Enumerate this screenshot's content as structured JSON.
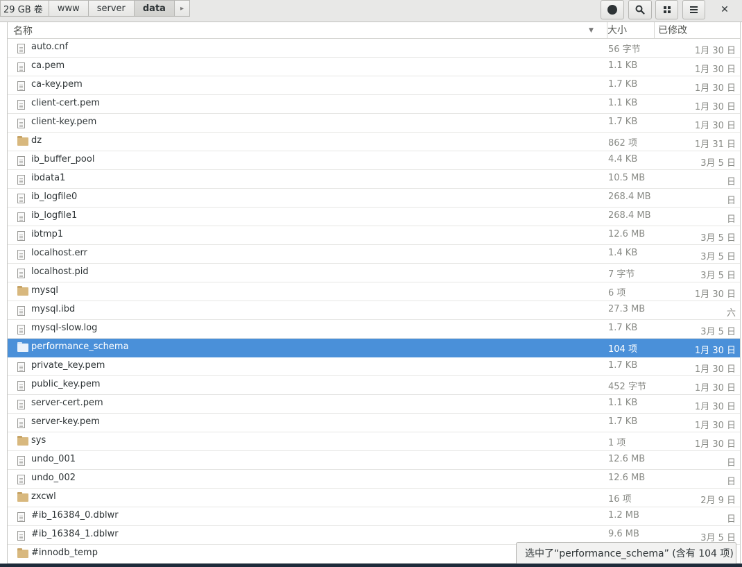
{
  "pathbar": {
    "disk": "29 GB 卷",
    "crumbs": [
      "www",
      "server",
      "data"
    ],
    "arrow": "▸"
  },
  "toolbar": {
    "close": "✕",
    "icons": [
      "record-icon",
      "search-icon",
      "grid-view-icon",
      "menu-icon",
      "close-icon"
    ]
  },
  "columns": {
    "name": "名称",
    "sort_indicator": "▼",
    "size": "大小",
    "modified": "已修改"
  },
  "files": [
    {
      "name": "auto.cnf",
      "type": "file",
      "size": "56 字节",
      "modified": "1月 30 日"
    },
    {
      "name": "ca.pem",
      "type": "file",
      "size": "1.1 KB",
      "modified": "1月 30 日"
    },
    {
      "name": "ca-key.pem",
      "type": "file",
      "size": "1.7 KB",
      "modified": "1月 30 日"
    },
    {
      "name": "client-cert.pem",
      "type": "file",
      "size": "1.1 KB",
      "modified": "1月 30 日"
    },
    {
      "name": "client-key.pem",
      "type": "file",
      "size": "1.7 KB",
      "modified": "1月 30 日"
    },
    {
      "name": "dz",
      "type": "folder",
      "size": "862 项",
      "modified": "1月 31 日"
    },
    {
      "name": "ib_buffer_pool",
      "type": "file",
      "size": "4.4 KB",
      "modified": "3月 5 日"
    },
    {
      "name": "ibdata1",
      "type": "file",
      "size": "10.5 MB",
      "modified": "日"
    },
    {
      "name": "ib_logfile0",
      "type": "file",
      "size": "268.4 MB",
      "modified": "日"
    },
    {
      "name": "ib_logfile1",
      "type": "file",
      "size": "268.4 MB",
      "modified": "日"
    },
    {
      "name": "ibtmp1",
      "type": "file",
      "size": "12.6 MB",
      "modified": "3月 5 日"
    },
    {
      "name": "localhost.err",
      "type": "file",
      "size": "1.4 KB",
      "modified": "3月 5 日"
    },
    {
      "name": "localhost.pid",
      "type": "file",
      "size": "7 字节",
      "modified": "3月 5 日"
    },
    {
      "name": "mysql",
      "type": "folder",
      "size": "6 项",
      "modified": "1月 30 日"
    },
    {
      "name": "mysql.ibd",
      "type": "file",
      "size": "27.3 MB",
      "modified": "六"
    },
    {
      "name": "mysql-slow.log",
      "type": "file",
      "size": "1.7 KB",
      "modified": "3月 5 日"
    },
    {
      "name": "performance_schema",
      "type": "folder",
      "size": "104 项",
      "modified": "1月 30 日",
      "selected": true
    },
    {
      "name": "private_key.pem",
      "type": "file",
      "size": "1.7 KB",
      "modified": "1月 30 日"
    },
    {
      "name": "public_key.pem",
      "type": "file",
      "size": "452 字节",
      "modified": "1月 30 日"
    },
    {
      "name": "server-cert.pem",
      "type": "file",
      "size": "1.1 KB",
      "modified": "1月 30 日"
    },
    {
      "name": "server-key.pem",
      "type": "file",
      "size": "1.7 KB",
      "modified": "1月 30 日"
    },
    {
      "name": "sys",
      "type": "folder",
      "size": "1 项",
      "modified": "1月 30 日"
    },
    {
      "name": "undo_001",
      "type": "file",
      "size": "12.6 MB",
      "modified": "日"
    },
    {
      "name": "undo_002",
      "type": "file",
      "size": "12.6 MB",
      "modified": "日"
    },
    {
      "name": "zxcwl",
      "type": "folder",
      "size": "16 项",
      "modified": "2月 9 日"
    },
    {
      "name": "#ib_16384_0.dblwr",
      "type": "file",
      "size": "1.2 MB",
      "modified": "日"
    },
    {
      "name": "#ib_16384_1.dblwr",
      "type": "file",
      "size": "9.6 MB",
      "modified": "3月 5 日"
    },
    {
      "name": "#innodb_temp",
      "type": "folder",
      "size": "",
      "modified": ""
    }
  ],
  "status": {
    "text": "选中了“performance_schema” (含有 104 项)"
  },
  "colors": {
    "selection": "#4a90d9",
    "folder": "#d8b87e",
    "secondary_text": "#888a85"
  }
}
